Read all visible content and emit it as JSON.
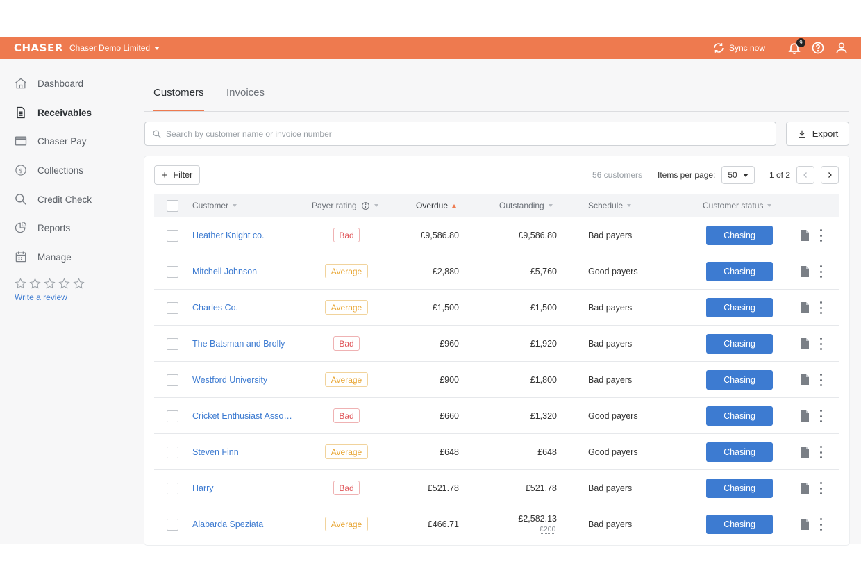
{
  "topbar": {
    "logo": "CHASER",
    "org_name": "Chaser Demo Limited",
    "sync_label": "Sync now",
    "notification_count": "9"
  },
  "sidebar": {
    "items": [
      {
        "label": "Dashboard",
        "icon": "home-icon"
      },
      {
        "label": "Receivables",
        "icon": "document-icon",
        "active": true
      },
      {
        "label": "Chaser Pay",
        "icon": "credit-card-icon"
      },
      {
        "label": "Collections",
        "icon": "dollar-circle-icon"
      },
      {
        "label": "Credit Check",
        "icon": "search-icon"
      },
      {
        "label": "Reports",
        "icon": "pie-chart-icon"
      },
      {
        "label": "Manage",
        "icon": "calendar-icon"
      }
    ],
    "review_label": "Write a review"
  },
  "tabs": [
    {
      "label": "Customers",
      "active": true
    },
    {
      "label": "Invoices",
      "active": false
    }
  ],
  "search": {
    "placeholder": "Search by customer name or invoice number",
    "value": ""
  },
  "export_label": "Export",
  "toolbar": {
    "filter_label": "Filter",
    "customer_count": "56 customers",
    "items_per_page_label": "Items per page:",
    "items_per_page_value": "50",
    "page_indicator": "1 of 2"
  },
  "table": {
    "headers": {
      "customer": "Customer",
      "payer_rating": "Payer rating",
      "overdue": "Overdue",
      "outstanding": "Outstanding",
      "schedule": "Schedule",
      "customer_status": "Customer status"
    },
    "rows": [
      {
        "customer": "Heather Knight co.",
        "rating": "Bad",
        "overdue": "£9,586.80",
        "outstanding": "£9,586.80",
        "schedule": "Bad payers",
        "status": "Chasing"
      },
      {
        "customer": "Mitchell Johnson",
        "rating": "Average",
        "overdue": "£2,880",
        "outstanding": "£5,760",
        "schedule": "Good payers",
        "status": "Chasing"
      },
      {
        "customer": "Charles Co.",
        "rating": "Average",
        "overdue": "£1,500",
        "outstanding": "£1,500",
        "schedule": "Bad payers",
        "status": "Chasing"
      },
      {
        "customer": "The Batsman and Brolly",
        "rating": "Bad",
        "overdue": "£960",
        "outstanding": "£1,920",
        "schedule": "Bad payers",
        "status": "Chasing"
      },
      {
        "customer": "Westford University",
        "rating": "Average",
        "overdue": "£900",
        "outstanding": "£1,800",
        "schedule": "Bad payers",
        "status": "Chasing"
      },
      {
        "customer": "Cricket Enthusiast Associ...",
        "rating": "Bad",
        "overdue": "£660",
        "outstanding": "£1,320",
        "schedule": "Good payers",
        "status": "Chasing"
      },
      {
        "customer": "Steven Finn",
        "rating": "Average",
        "overdue": "£648",
        "outstanding": "£648",
        "schedule": "Good payers",
        "status": "Chasing"
      },
      {
        "customer": "Harry",
        "rating": "Bad",
        "overdue": "£521.78",
        "outstanding": "£521.78",
        "schedule": "Bad payers",
        "status": "Chasing"
      },
      {
        "customer": "Alabarda Speziata",
        "rating": "Average",
        "overdue": "£466.71",
        "outstanding": "£2,582.13",
        "outstanding_sub": "£200",
        "schedule": "Bad payers",
        "status": "Chasing"
      }
    ]
  },
  "colors": {
    "brand": "#ee7a4f",
    "link": "#3d7bd1",
    "status_button": "#3d7bd1",
    "bad": "#e0575b",
    "average": "#e8a532"
  }
}
